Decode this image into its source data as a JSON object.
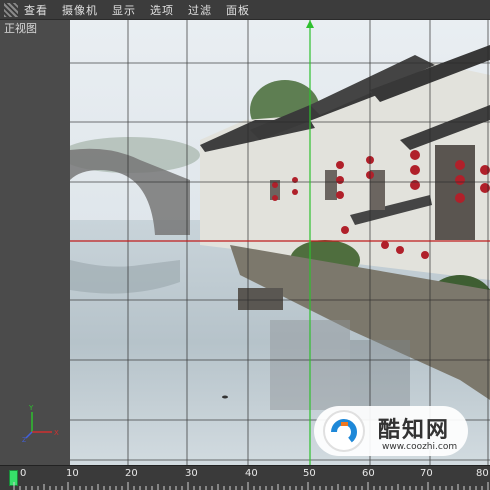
{
  "menu": {
    "items": [
      "查看",
      "摄像机",
      "显示",
      "选项",
      "过滤",
      "面板"
    ]
  },
  "viewport": {
    "name": "正视图",
    "gizmo_axes": [
      "Y",
      "X",
      "Z"
    ]
  },
  "timeline": {
    "ticks": [
      "0",
      "10",
      "20",
      "30",
      "40",
      "50",
      "60",
      "70",
      "80"
    ],
    "current_frame": 0
  },
  "watermark": {
    "name": "酷知网",
    "url": "www.coozhi.com"
  },
  "colors": {
    "menubar": "#3c3c3c",
    "panel": "#4b4b4b",
    "grid": "#2a2a2a",
    "y_axis": "#2ec02e",
    "x_axis": "#c01c1c",
    "thumb": "#37e06a"
  }
}
